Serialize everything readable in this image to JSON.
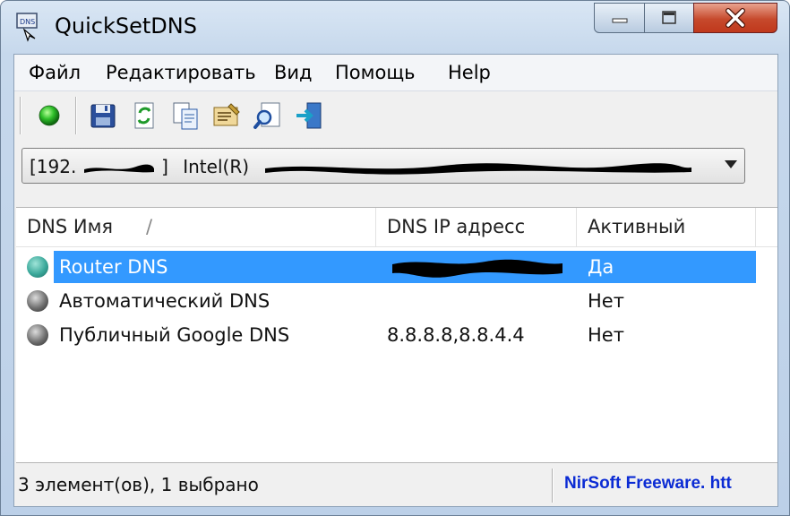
{
  "window": {
    "title": "QuickSetDNS",
    "app_icon": "dns-app-icon",
    "controls": [
      "minimize-icon",
      "maximize-icon",
      "close-icon"
    ],
    "close_color": "#c6492c"
  },
  "menu": {
    "items": [
      "Файл",
      "Редактировать",
      "Вид",
      "Помощь",
      "Help"
    ]
  },
  "toolbar": {
    "buttons": [
      "activate-dns-icon",
      "save-icon",
      "refresh-icon",
      "copy-icon",
      "properties-icon",
      "find-icon",
      "exit-icon"
    ]
  },
  "adapter": {
    "ip_prefix": "[192.",
    "ip_suffix": "]",
    "name": "Intel(R)",
    "redacted": true
  },
  "list": {
    "columns": [
      "DNS Имя",
      "DNS IP адресс",
      "Активный"
    ],
    "sort_indicator": "/",
    "rows": [
      {
        "name": "Router DNS",
        "ip": "",
        "ip_redacted": true,
        "active": "Да",
        "status_icon": "green-dot-icon",
        "selected": true
      },
      {
        "name": "Автоматический DNS",
        "ip": "",
        "ip_redacted": false,
        "active": "Нет",
        "status_icon": "gray-dot-icon",
        "selected": false
      },
      {
        "name": "Публичный Google DNS",
        "ip": "8.8.8.8,8.8.4.4",
        "ip_redacted": false,
        "active": "Нет",
        "status_icon": "gray-dot-icon",
        "selected": false
      }
    ],
    "selection_color": "#3399ff"
  },
  "statusbar": {
    "left": "3 элемент(ов), 1 выбрано",
    "right": "NirSoft Freeware.  htt",
    "link_color": "#0b2bd4"
  }
}
